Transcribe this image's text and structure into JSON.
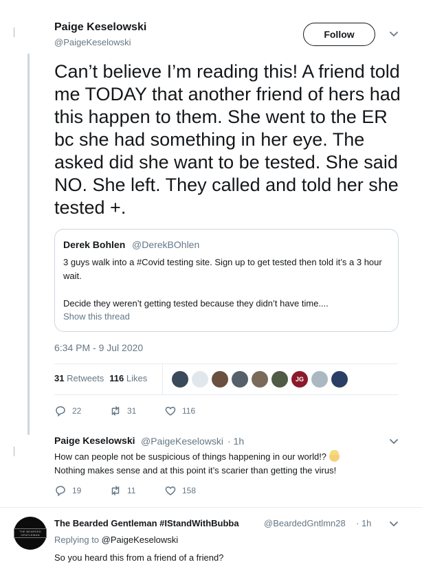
{
  "main_tweet": {
    "author_name": "Paige Keselowski",
    "author_handle": "@PaigeKeselowski",
    "follow_label": "Follow",
    "text": "Can’t believe I’m reading this! A friend told me TODAY that another friend of hers had this happen to them. She went to the ER bc she had something in her eye. The asked did she want to be tested. She said NO. She left. They called and told her she tested +.",
    "quote": {
      "author_name": "Derek Bohlen",
      "author_handle": "@DerekBOhlen",
      "line1": "3 guys walk into a #Covid testing site. Sign up to get tested then told it’s a 3 hour wait.",
      "line2": "Decide they weren’t getting tested because they didn’t have time....",
      "show_thread": "Show this thread"
    },
    "timestamp": "6:34 PM - 9 Jul 2020",
    "retweets_count": "31",
    "retweets_label": "Retweets",
    "likes_count": "116",
    "likes_label": "Likes",
    "liker_avatars": [
      {
        "initials": "",
        "color": "#3a4a5a"
      },
      {
        "initials": "",
        "color": "#e1e8ed"
      },
      {
        "initials": "",
        "color": "#6b4f3f"
      },
      {
        "initials": "",
        "color": "#55606a"
      },
      {
        "initials": "",
        "color": "#7a6a5a"
      },
      {
        "initials": "",
        "color": "#4f5b45"
      },
      {
        "initials": "JG",
        "color": "#8b1a2b"
      },
      {
        "initials": "",
        "color": "#aab8c2"
      },
      {
        "initials": "",
        "color": "#2b3f66"
      }
    ],
    "actions": {
      "replies": "22",
      "retweets": "31",
      "likes": "116"
    }
  },
  "reply1": {
    "author_name": "Paige Keselowski",
    "author_handle": "@PaigeKeselowski",
    "time": "· 1h",
    "line1": "How can people not be suspicious of things happening in our world!?",
    "line2": "Nothing makes sense and at this point it’s scarier than getting the virus!",
    "actions": {
      "replies": "19",
      "retweets": "11",
      "likes": "158"
    }
  },
  "reply2": {
    "author_name": "The Bearded Gentleman #IStandWithBubba",
    "author_handle": "@BeardedGntlmn28",
    "time": "· 1h",
    "avatar_label": "THE BEARDED GENTLEMAN",
    "replying_prefix": "Replying to",
    "replying_handle": "@PaigeKeselowski",
    "text": "So you heard this from a friend of a friend?"
  },
  "icons": [
    "chevron-down-icon",
    "reply-icon",
    "retweet-icon",
    "heart-icon"
  ],
  "colors": {
    "text": "#14171a",
    "muted": "#657786",
    "border": "#ccd6dd",
    "divider": "#e6ecf0"
  }
}
